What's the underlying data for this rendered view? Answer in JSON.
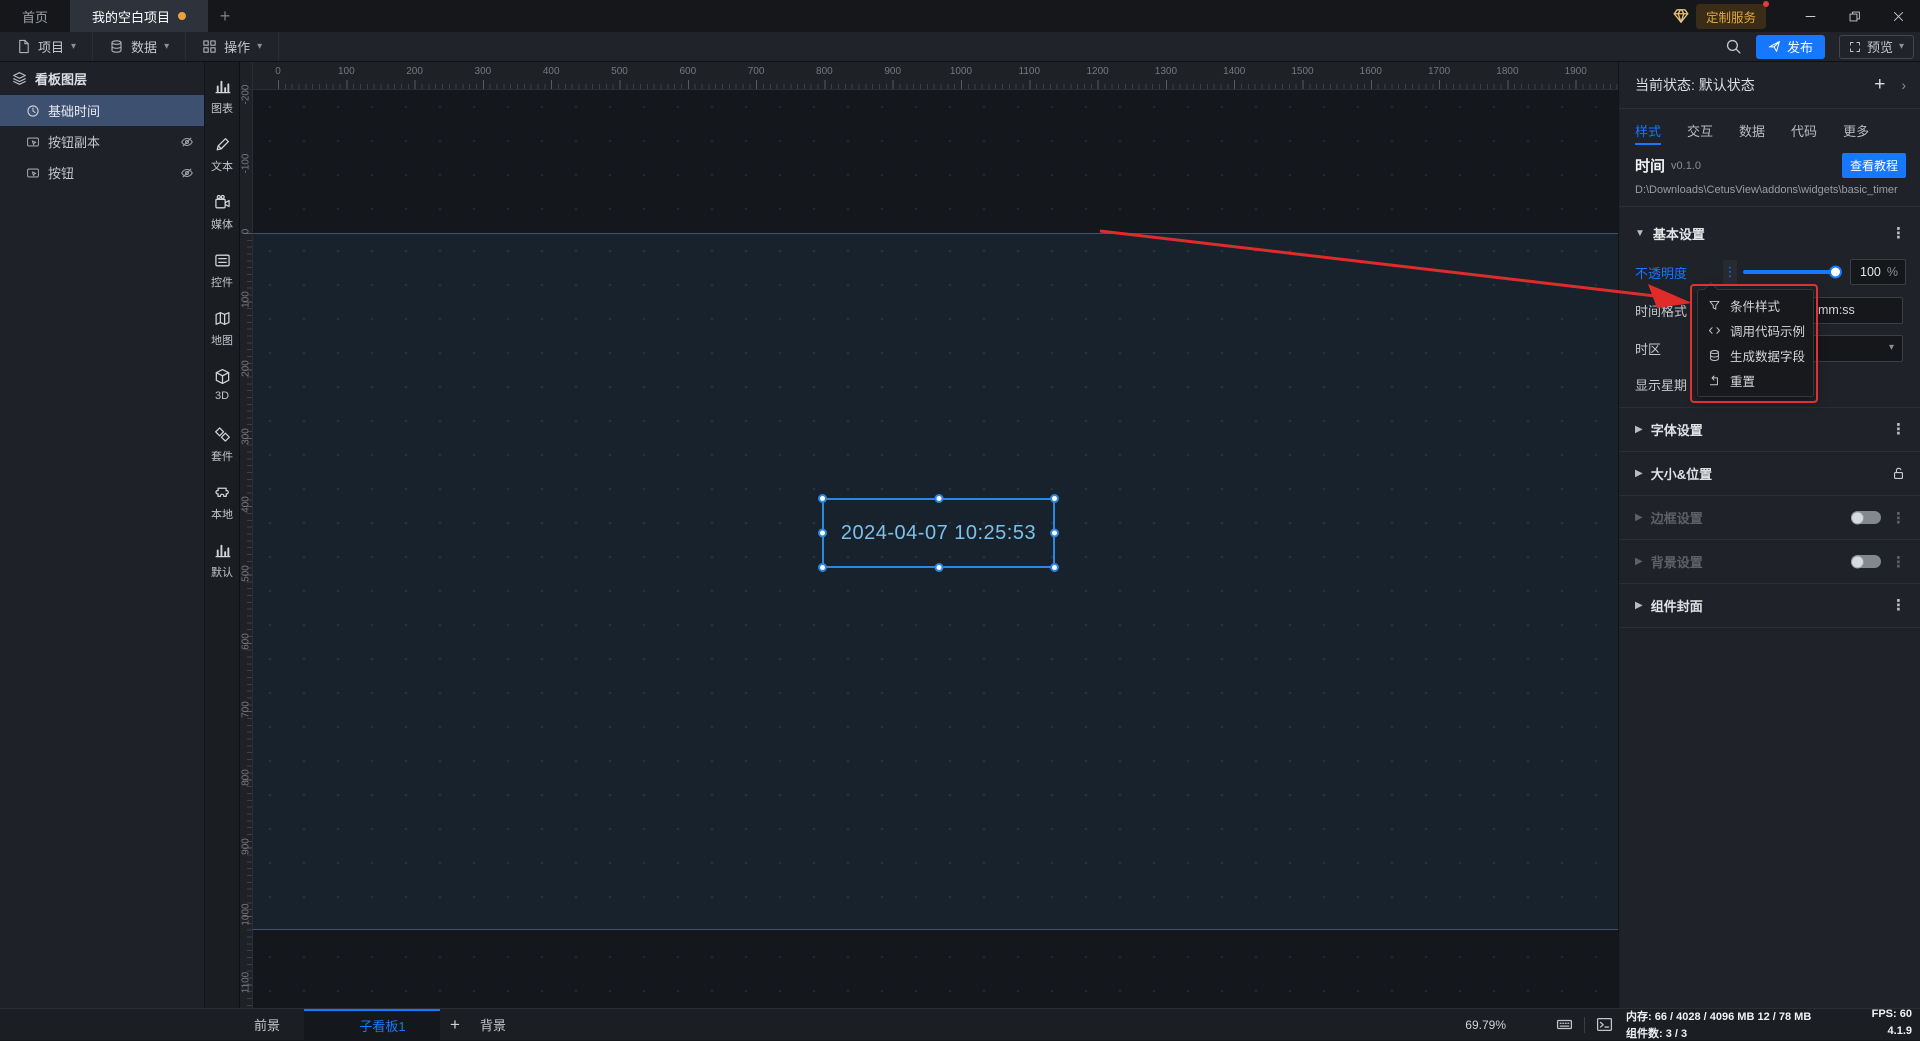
{
  "titlebar": {
    "tabs": [
      {
        "label": "首页",
        "active": false
      },
      {
        "label": "我的空白项目",
        "active": true,
        "modified": true
      }
    ],
    "new_tab": "+",
    "service_badge": "定制服务"
  },
  "menubar": {
    "items": [
      {
        "label": "项目",
        "icon": "file-icon"
      },
      {
        "label": "数据",
        "icon": "db-icon"
      },
      {
        "label": "操作",
        "icon": "grid-icon"
      }
    ],
    "publish_label": "发布",
    "preview_label": "预览"
  },
  "layers_panel": {
    "title": "看板图层",
    "items": [
      {
        "label": "基础时间",
        "icon": "clock-icon",
        "selected": true,
        "hidden": false
      },
      {
        "label": "按钮副本",
        "icon": "widget-icon",
        "selected": false,
        "hidden": true
      },
      {
        "label": "按钮",
        "icon": "widget-icon",
        "selected": false,
        "hidden": true
      }
    ]
  },
  "widget_toolbar": {
    "items": [
      {
        "label": "图表",
        "icon": "chart-icon"
      },
      {
        "label": "文本",
        "icon": "pen-icon"
      },
      {
        "label": "媒体",
        "icon": "media-icon"
      },
      {
        "label": "控件",
        "icon": "control-icon"
      },
      {
        "label": "地图",
        "icon": "map-icon"
      },
      {
        "label": "3D",
        "icon": "cube-icon"
      },
      {
        "label": "套件",
        "icon": "kit-icon"
      },
      {
        "label": "本地",
        "icon": "puzzle-icon"
      },
      {
        "label": "默认",
        "icon": "chart-icon"
      }
    ]
  },
  "canvas": {
    "widget_text": "2024-04-07 10:25:53",
    "h_ruler": [
      0,
      100,
      200,
      300,
      400,
      500,
      600,
      700,
      800,
      900,
      1000,
      1100,
      1200,
      1300,
      1400,
      1500,
      1600,
      1700,
      1800,
      1900
    ],
    "v_ruler": [
      -200,
      -100,
      0,
      100,
      200,
      300,
      400,
      500,
      600,
      700,
      800,
      900,
      1000,
      1100
    ]
  },
  "right_panel": {
    "state_label": "当前状态:",
    "state_value": "默认状态",
    "tabs": [
      "样式",
      "交互",
      "数据",
      "代码",
      "更多"
    ],
    "active_tab": "样式",
    "widget_name": "时间",
    "widget_version": "v0.1.0",
    "tutorial_button": "查看教程",
    "widget_path": "D:\\Downloads\\CetusView\\addons\\widgets\\basic_timer",
    "basic_section_title": "基本设置",
    "opacity": {
      "label": "不透明度",
      "value": "100",
      "unit": "%"
    },
    "time_format": {
      "label": "时间格式",
      "visible_value": "mm:ss"
    },
    "timezone_label": "时区",
    "show_week_label": "显示星期",
    "sections": [
      {
        "label": "字体设置",
        "kebab": true
      },
      {
        "label": "大小&位置",
        "lock": true
      },
      {
        "label": "边框设置",
        "toggle": true,
        "kebab": true,
        "disabled": true
      },
      {
        "label": "背景设置",
        "toggle": true,
        "kebab": true,
        "disabled": true
      },
      {
        "label": "组件封面",
        "kebab": true
      }
    ]
  },
  "context_menu": {
    "items": [
      {
        "label": "条件样式",
        "icon": "funnel-icon"
      },
      {
        "label": "调用代码示例",
        "icon": "code-icon"
      },
      {
        "label": "生成数据字段",
        "icon": "db-icon"
      },
      {
        "label": "重置",
        "icon": "reset-icon"
      }
    ]
  },
  "bottombar": {
    "foreground_label": "前景",
    "board_tab": "子看板1",
    "add_board": "+",
    "background_label": "背景",
    "zoom": "69.79%",
    "memory_label": "内存:",
    "memory_value": "66 / 4028 / 4096 MB 12 / 78 MB",
    "fps_label": "FPS:",
    "fps_value": "60",
    "widget_count_label": "组件数:",
    "widget_count_value": "3 / 3",
    "version": "4.1.9"
  }
}
